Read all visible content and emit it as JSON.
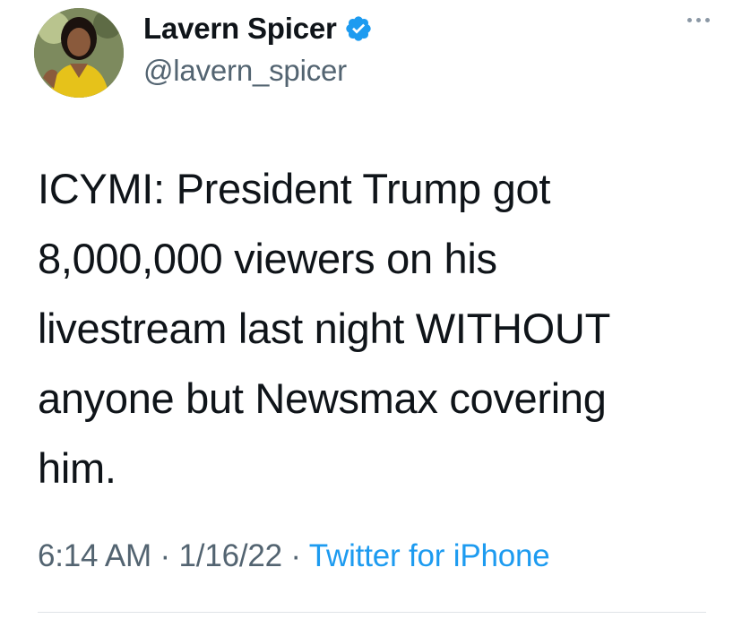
{
  "author": {
    "display_name": "Lavern Spicer",
    "handle": "@lavern_spicer",
    "verified": true
  },
  "tweet": {
    "text_lines": [
      "ICYMI: President Trump got",
      "8,000,000 viewers on his",
      "livestream last night WITHOUT",
      "anyone but Newsmax covering",
      "him."
    ],
    "time": "6:14 AM",
    "separator": " · ",
    "date": "1/16/22",
    "source": "Twitter for iPhone"
  },
  "icons": {
    "verified": "verified-badge-icon",
    "more": "more-options-icon"
  },
  "colors": {
    "text_primary": "#0f1419",
    "text_secondary": "#536471",
    "accent": "#1d9bf0"
  }
}
